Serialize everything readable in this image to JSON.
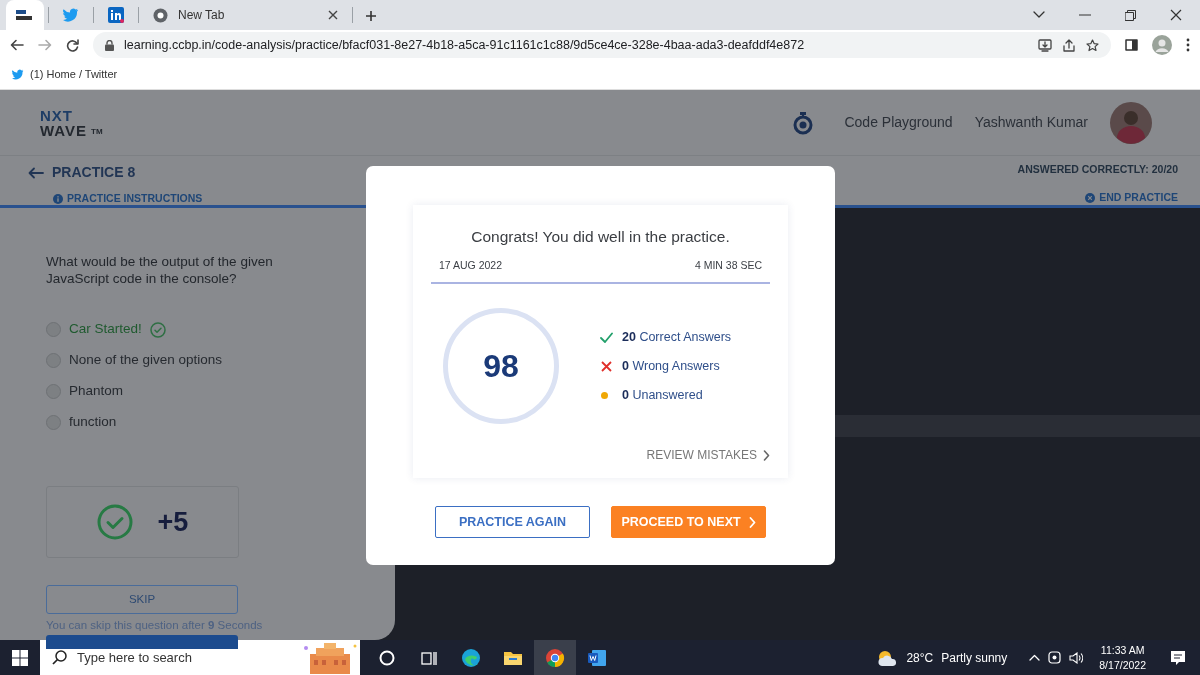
{
  "browser": {
    "tabs": [
      {
        "kind": "logo",
        "selected": true
      },
      {
        "kind": "bird",
        "selected": false
      },
      {
        "kind": "square",
        "selected": false
      },
      {
        "kind": "globe",
        "label": "New Tab",
        "selected": false
      }
    ],
    "url": "learning.ccbp.in/code-analysis/practice/bfacf031-8e27-4b18-a5ca-91c1161c1c88/9d5ce4ce-328e-4baa-ada3-deafddf4e872",
    "bookmarks": [
      {
        "label": "(1) Home / Twitter"
      }
    ]
  },
  "app": {
    "logo": {
      "line_1": "NXT",
      "line_2": "WAVE",
      "mark": "TM"
    },
    "nav_link": "Code Playground",
    "user_name": "Yashwanth Kumar",
    "practice": {
      "title": "PRACTICE 8",
      "instructions_link": "PRACTICE INSTRUCTIONS",
      "answered": "ANSWERED CORRECTLY: 20/20",
      "end_link": "END PRACTICE"
    },
    "question": {
      "text": "What would be the output of the given JavaScript code in the console?",
      "options": [
        {
          "label": "Car Started!",
          "correct": true
        },
        {
          "label": "None of the given options",
          "correct": false
        },
        {
          "label": "Phantom",
          "correct": false
        },
        {
          "label": "function",
          "correct": false
        }
      ],
      "points": "+5",
      "skip_button": "SKIP",
      "skip_note": "You can skip this question after **9** Seconds"
    }
  },
  "modal": {
    "message": "Congrats! You did well in the practice.",
    "date": "17 AUG 2022",
    "duration": "4 MIN 38 SEC",
    "score": "98",
    "stats": [
      {
        "kind": "correct",
        "count": "20",
        "label": "Correct Answers"
      },
      {
        "kind": "wrong",
        "count": "0",
        "label": "Wrong Answers"
      },
      {
        "kind": "unanswered",
        "count": "0",
        "label": "Unanswered"
      }
    ],
    "review_link": "REVIEW MISTAKES",
    "buttons": [
      {
        "kind": "outline",
        "label": "PRACTICE AGAIN"
      },
      {
        "kind": "solid",
        "label": "PROCEED TO NEXT"
      }
    ]
  },
  "taskbar": {
    "search_placeholder": "Type here to search",
    "apps": [
      {
        "kind": "circle",
        "selected": false
      },
      {
        "kind": "taskview",
        "selected": false
      },
      {
        "kind": "edge",
        "selected": false
      },
      {
        "kind": "folder",
        "selected": false
      },
      {
        "kind": "chrome",
        "selected": true
      },
      {
        "kind": "word",
        "selected": false
      }
    ],
    "weather": {
      "temperature": "28°C",
      "condition": "Partly sunny"
    },
    "time": "11:33 AM",
    "date": "8/17/2022"
  }
}
